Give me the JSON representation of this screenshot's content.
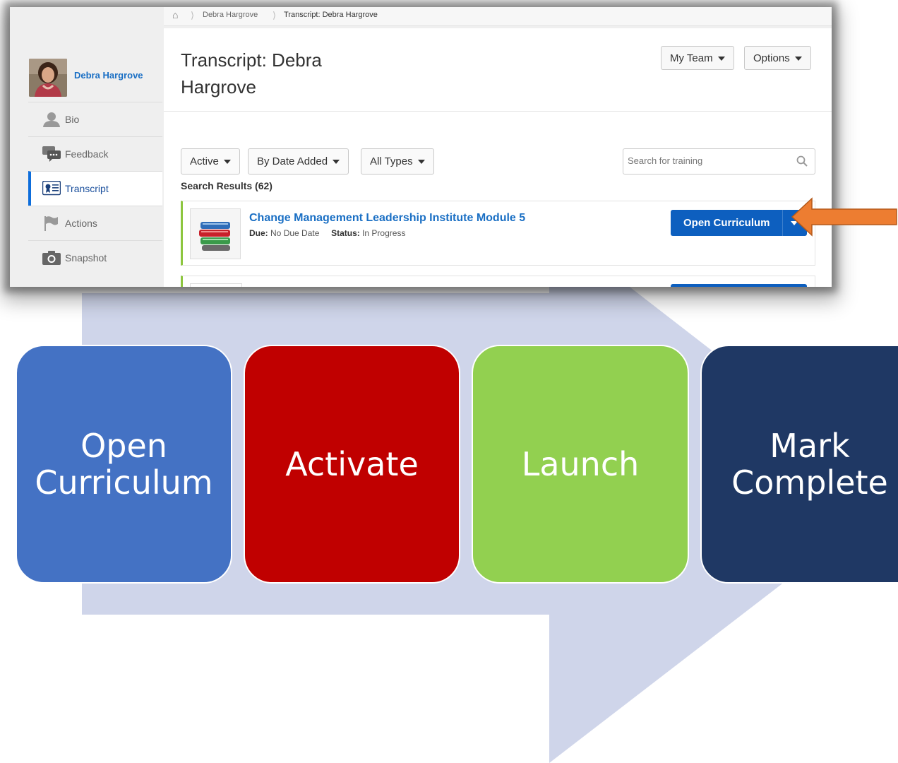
{
  "breadcrumb": {
    "items": [
      "Debra Hargrove",
      "Transcript: Debra Hargrove"
    ]
  },
  "profile": {
    "name": "Debra Hargrove"
  },
  "sidebar": {
    "items": [
      {
        "label": "Bio",
        "icon": "person-icon"
      },
      {
        "label": "Feedback",
        "icon": "speech-bubbles-icon"
      },
      {
        "label": "Transcript",
        "icon": "transcript-icon",
        "active": true
      },
      {
        "label": "Actions",
        "icon": "flag-icon"
      },
      {
        "label": "Snapshot",
        "icon": "camera-icon"
      }
    ]
  },
  "header": {
    "title": "Transcript: Debra Hargrove",
    "my_team_label": "My Team",
    "options_label": "Options"
  },
  "filters": {
    "status": "Active",
    "sort": "By Date Added",
    "type": "All Types"
  },
  "search": {
    "placeholder": "Search for training"
  },
  "results": {
    "label": "Search Results (62)"
  },
  "training_card": {
    "title": "Change Management Leadership Institute Module 5",
    "due_label": "Due:",
    "due_value": "No Due Date",
    "status_label": "Status:",
    "status_value": "In Progress",
    "action_label": "Open Curriculum",
    "accent_color": "#8dc63f"
  },
  "process_steps": [
    {
      "label": "Open Curriculum",
      "color": "#4472c4"
    },
    {
      "label": "Activate",
      "color": "#c00000"
    },
    {
      "label": "Launch",
      "color": "#92d050"
    },
    {
      "label": "Mark Complete",
      "color": "#1f3864"
    }
  ],
  "colors": {
    "primary_button": "#0d5fbf",
    "link": "#1a6fc4",
    "callout_arrow": "#ed7d31",
    "background_arrow": "#cfd5ea"
  }
}
